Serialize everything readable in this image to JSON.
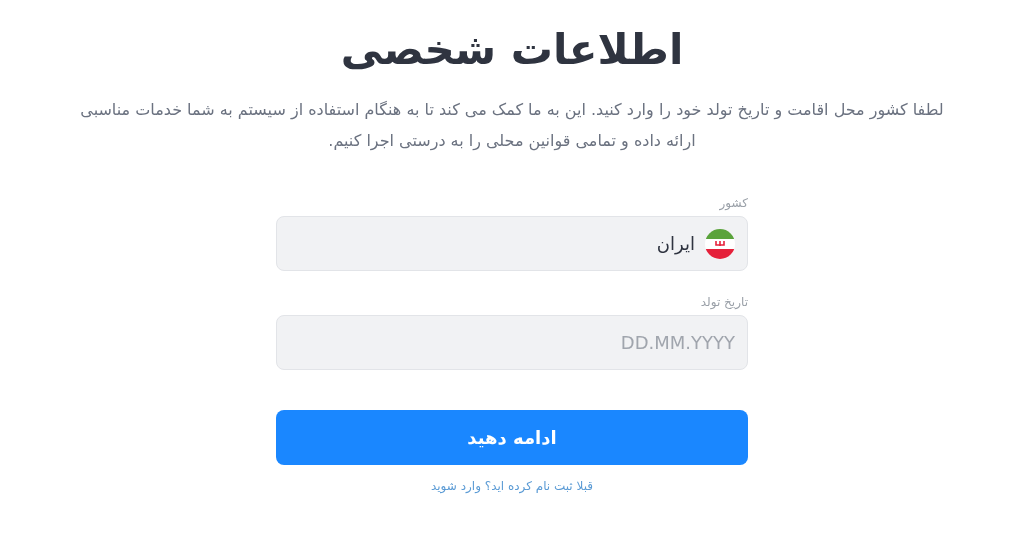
{
  "title": "اطلاعات شخصی",
  "description": "لطفا کشور محل اقامت و تاریخ تولد خود را وارد کنید. این به ما کمک می کند تا به هنگام استفاده از سیستم به شما خدمات مناسبی ارائه داده و تمامی قوانین محلی را به درستی اجرا کنیم.",
  "fields": [
    {
      "kind": "country",
      "label": "کشور",
      "value": "ایران"
    },
    {
      "kind": "date",
      "label": "تاریخ تولد",
      "placeholder": "DD.MM.YYYY"
    }
  ],
  "submit_button": "ادامه دهید",
  "login_link": "قبلا ثبت نام کرده اید؟ وارد شوید"
}
